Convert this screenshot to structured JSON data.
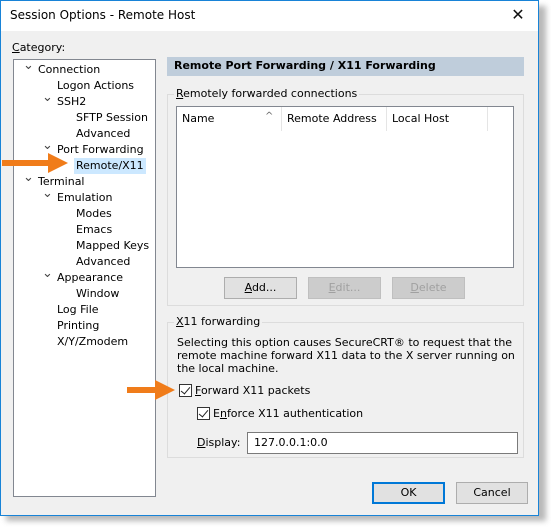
{
  "window": {
    "title": "Session Options - Remote Host",
    "close_icon": "close-icon"
  },
  "category": {
    "label_prefix": "C",
    "label_rest": "ategory:",
    "items": [
      {
        "label": "Connection",
        "level": 0,
        "expanded": true
      },
      {
        "label": "Logon Actions",
        "level": 1
      },
      {
        "label": "SSH2",
        "level": 1,
        "expanded": true
      },
      {
        "label": "SFTP Session",
        "level": 2
      },
      {
        "label": "Advanced",
        "level": 2
      },
      {
        "label": "Port Forwarding",
        "level": 1,
        "expanded": true
      },
      {
        "label": "Remote/X11",
        "level": 2,
        "selected": true
      },
      {
        "label": "Terminal",
        "level": 0,
        "expanded": true
      },
      {
        "label": "Emulation",
        "level": 1,
        "expanded": true
      },
      {
        "label": "Modes",
        "level": 2
      },
      {
        "label": "Emacs",
        "level": 2
      },
      {
        "label": "Mapped Keys",
        "level": 2
      },
      {
        "label": "Advanced",
        "level": 2
      },
      {
        "label": "Appearance",
        "level": 1,
        "expanded": true
      },
      {
        "label": "Window",
        "level": 2
      },
      {
        "label": "Log File",
        "level": 1
      },
      {
        "label": "Printing",
        "level": 1
      },
      {
        "label": "X/Y/Zmodem",
        "level": 1
      }
    ]
  },
  "panel": {
    "header": "Remote Port Forwarding / X11 Forwarding",
    "remote_group": {
      "label_prefix": "R",
      "label_rest": "emotely forwarded connections",
      "columns": [
        "Name",
        "Remote Address",
        "Local Host"
      ],
      "sort_indicator": "^",
      "rows": [],
      "buttons": {
        "add": {
          "prefix": "A",
          "rest": "dd...",
          "enabled": true
        },
        "edit": {
          "prefix": "E",
          "rest": "dit...",
          "enabled": false
        },
        "delete": {
          "prefix": "D",
          "rest": "elete",
          "enabled": false
        }
      }
    },
    "x11_group": {
      "label_prefix": "X",
      "label_rest": "11 forwarding",
      "description": "Selecting this option causes SecureCRT® to request that the remote machine forward X11 data to the X server running on the local machine.",
      "forward_packets": {
        "prefix": "F",
        "rest": "orward X11 packets",
        "checked": true
      },
      "enforce_auth": {
        "pre": "E",
        "u": "n",
        "rest": "force X11 authentication",
        "checked": true
      },
      "display": {
        "prefix": "D",
        "rest": "isplay:",
        "value": "127.0.0.1:0.0"
      }
    }
  },
  "footer": {
    "ok": "OK",
    "cancel": "Cancel"
  },
  "annotations": {
    "arrow_color": "#f07c1a"
  }
}
